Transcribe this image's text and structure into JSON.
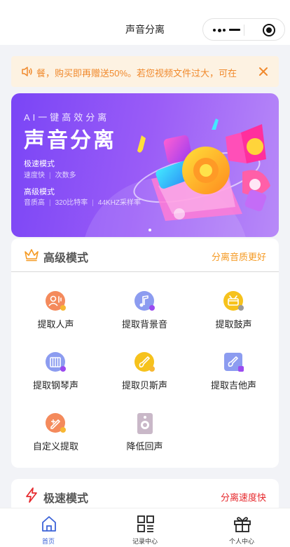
{
  "nav": {
    "title": "声音分离"
  },
  "notice": {
    "text": "餐，购买即再赠送50%。若您视频文件过大，可在"
  },
  "banner": {
    "subtitle": "AI一键高效分离",
    "title": "声音分离",
    "mode1_title": "极速模式",
    "mode1_desc": [
      "速度快",
      "次数多"
    ],
    "mode2_title": "高级模式",
    "mode2_desc": [
      "音质高",
      "320比特率",
      "44KHZ采样率"
    ]
  },
  "advanced": {
    "title": "高级模式",
    "tagline": "分离音质更好",
    "items": [
      {
        "label": "提取人声",
        "icon": "vocal-icon",
        "color": "#f48a5c"
      },
      {
        "label": "提取背景音",
        "icon": "music-note-icon",
        "color": "#8c9cf0"
      },
      {
        "label": "提取鼓声",
        "icon": "drum-icon",
        "color": "#f6c21c"
      },
      {
        "label": "提取钢琴声",
        "icon": "piano-icon",
        "color": "#8c9cf0"
      },
      {
        "label": "提取贝斯声",
        "icon": "bass-icon",
        "color": "#f6c21c"
      },
      {
        "label": "提取吉他声",
        "icon": "guitar-icon",
        "color": "#8c9cf0"
      },
      {
        "label": "自定义提取",
        "icon": "custom-icon",
        "color": "#f48a5c"
      },
      {
        "label": "降低回声",
        "icon": "speaker-icon",
        "color": "#c9b8c8"
      }
    ]
  },
  "fast": {
    "title": "极速模式",
    "tagline": "分离速度快"
  },
  "tabbar": {
    "items": [
      {
        "label": "首页",
        "active": true,
        "icon": "home-icon"
      },
      {
        "label": "记录中心",
        "active": false,
        "icon": "grid-list-icon"
      },
      {
        "label": "个人中心",
        "active": false,
        "icon": "gift-icon"
      }
    ]
  },
  "colors": {
    "accent_orange": "#f59a23",
    "fast_red": "#e6282c",
    "tab_active": "#3c63d8",
    "notice_text": "#f0892c",
    "banner_purple": "#7a45f6"
  }
}
